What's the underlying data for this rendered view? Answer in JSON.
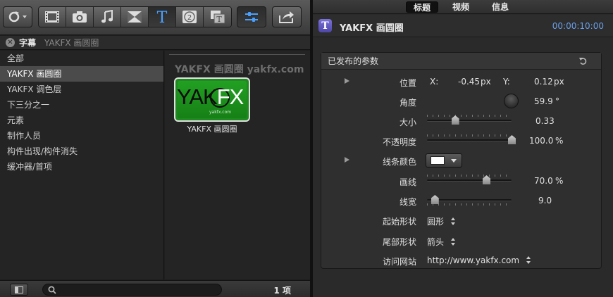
{
  "toolbar": {
    "icons": [
      "rotate-icon",
      "filmstrip-icon",
      "camera-icon",
      "music-icon",
      "transition-icon",
      "titles-icon",
      "generators-icon",
      "themes-icon",
      "adjust-icon",
      "share-icon"
    ]
  },
  "library": {
    "title": "字幕",
    "subtitle": "YAKFX 画圆圈",
    "categories": [
      "全部",
      "YAKFX 画圆圈",
      "YAKFX 调色层",
      "下三分之一",
      "元素",
      "制作人员",
      "构件出现/构件消失",
      "缓冲器/首项"
    ],
    "selected_index": 1
  },
  "browser": {
    "group_title": "YAKFX 画圆圈 yakfx.com",
    "thumb_logo_a": "YAK",
    "thumb_logo_b": "FX",
    "thumb_url": "yakfx.com",
    "thumb_label": "YAKFX 画圆圈"
  },
  "footer": {
    "search_placeholder": "",
    "count": "1 项"
  },
  "inspector": {
    "tabs": [
      "标题",
      "视频",
      "信息"
    ],
    "active_tab": 0,
    "title": "YAKFX 画圆圈",
    "timecode": "00:00:10:00",
    "section_title": "已发布的参数",
    "colors": {
      "accent": "#6a9fe8",
      "badge": "#6a62c8",
      "line_color": "#ffffff"
    },
    "params": {
      "position": {
        "label": "位置",
        "x_label": "X:",
        "x": "-0.45",
        "x_unit": "px",
        "y_label": "Y:",
        "y": "0.12",
        "y_unit": "px"
      },
      "angle": {
        "label": "角度",
        "value": "59.9",
        "unit": "°"
      },
      "size": {
        "label": "大小",
        "value": "0.33",
        "level": 0.33
      },
      "opacity": {
        "label": "不透明度",
        "value": "100.0",
        "unit": "%",
        "level": 1.0
      },
      "line_color": {
        "label": "线条颜色"
      },
      "draw": {
        "label": "画线",
        "value": "70.0",
        "unit": "%",
        "level": 0.7
      },
      "line_width": {
        "label": "线宽",
        "value": "9.0",
        "level": 0.09
      },
      "start_shape": {
        "label": "起始形状",
        "value": "圆形"
      },
      "end_shape": {
        "label": "尾部形状",
        "value": "箭头"
      },
      "website": {
        "label": "访问网站",
        "value": "http://www.yakfx.com"
      }
    }
  }
}
